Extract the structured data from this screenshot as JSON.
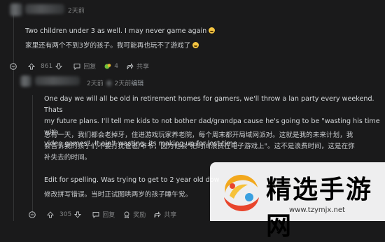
{
  "comment1": {
    "time": "2天前",
    "text_en": "Two children under 3 as well. I may never game again",
    "text_zh": "家里还有两个不到3岁的孩子。我可能再也玩不了游戏了",
    "upvotes": "861",
    "reply_label": "回复",
    "award_count": "4",
    "share_label": "共享"
  },
  "comment2": {
    "time": "2天前",
    "edited_label": "编辑",
    "para1_lines": [
      "One day we will all be old in retirement homes for gamers, we'll throw a lan party every weekend. Thats",
      "my future plans. I'll tell me kids to not bother dad/grandpa cause he's going to be \"wasting his time with",
      "video games\". It ain't wasting, its making up for lost time."
    ],
    "para1_zh_lines": [
      "总有一天，我们都会老掉牙，住进游戏玩家养老院，每个周末都开局域网派对。这就是我的未来计划，我",
      "会告诉我的孩子们不要打扰爸爸/爷爷，因为他会\"把时间浪费在电子游戏上\"。这不是浪费时间，这是在弥",
      "补失去的时间。"
    ],
    "para2": "Edit for spelling. Was trying to get to 2 year old dow",
    "para2_zh": "修改拼写错误。当时正试图哄两岁的孩子睡午觉。",
    "upvotes": "305",
    "reply_label": "回复",
    "award_label": "奖励",
    "share_label": "共享"
  },
  "watermark": {
    "title": "精选手游网",
    "url": "www.tzymjx.net"
  },
  "colors": {
    "background": "#1a1a1b",
    "text": "#d7dadc",
    "meta": "#818384"
  }
}
